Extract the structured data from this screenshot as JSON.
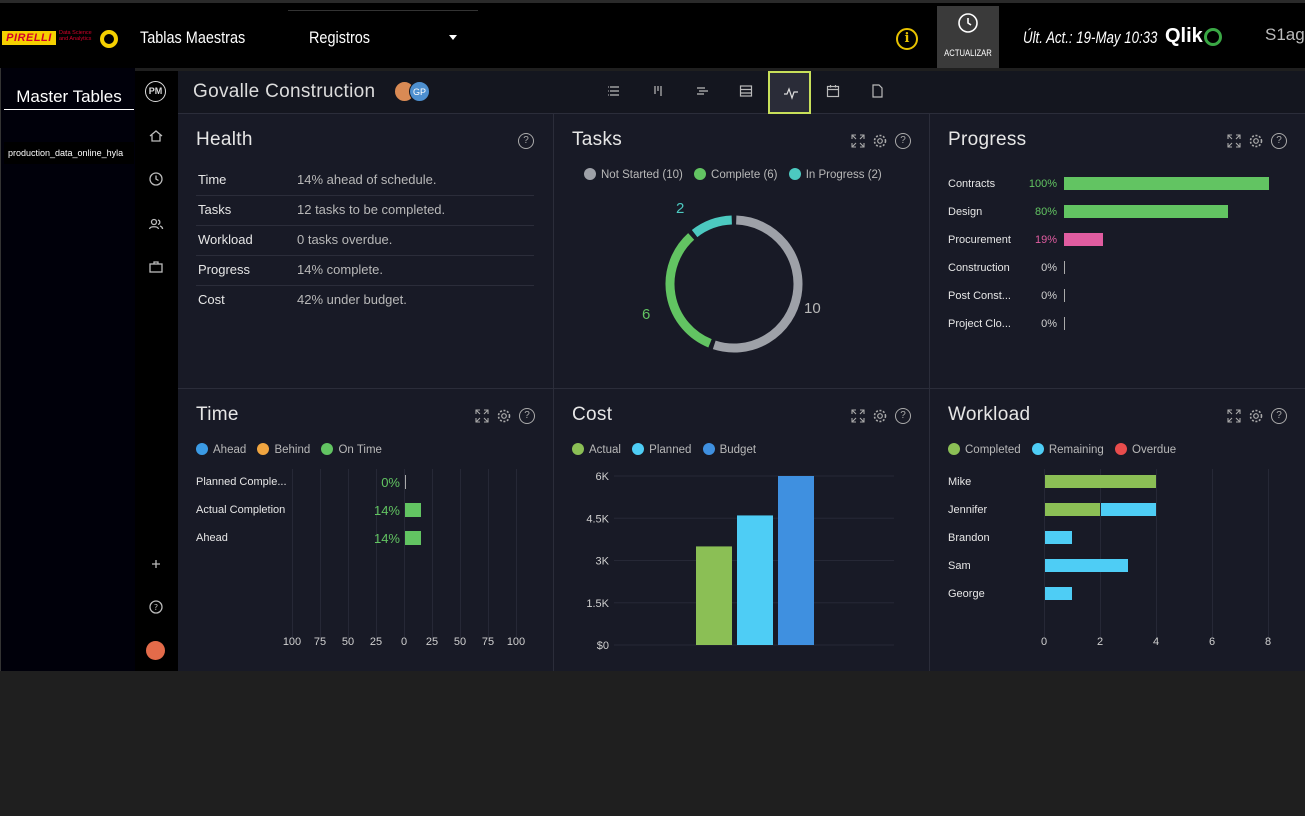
{
  "topbar": {
    "brand": "PIRELLI",
    "brand_sub": "Data Science and Analytics",
    "title": "Tablas Maestras",
    "dropdown": "Registros",
    "info_icon": "info-icon",
    "refresh_label": "ACTUALIZAR",
    "last_update": "Últ. Act.: 19-May 10:33",
    "qlik": "Qlik",
    "partner": "S1ag"
  },
  "qpanel": {
    "title": "Master Tables",
    "items": [
      "production_data_online_hyla"
    ]
  },
  "rail": {
    "logo": "PM",
    "icons": [
      "home-icon",
      "clock-icon",
      "users-icon",
      "briefcase-icon",
      "plus-icon",
      "help-icon"
    ]
  },
  "header": {
    "project": "Govalle Construction",
    "avatar2": "GP",
    "views": [
      "list-view",
      "gantt-view",
      "board-view",
      "sheet-view",
      "dashboard-view",
      "calendar-view",
      "file-view"
    ]
  },
  "health": {
    "title": "Health",
    "rows": [
      {
        "k": "Time",
        "v": "14% ahead of schedule."
      },
      {
        "k": "Tasks",
        "v": "12 tasks to be completed."
      },
      {
        "k": "Workload",
        "v": "0 tasks overdue."
      },
      {
        "k": "Progress",
        "v": "14% complete."
      },
      {
        "k": "Cost",
        "v": "42% under budget."
      }
    ]
  },
  "tasks": {
    "title": "Tasks",
    "legend": [
      "Not Started (10)",
      "Complete (6)",
      "In Progress (2)"
    ],
    "colors": [
      "#9ea1a8",
      "#62c462",
      "#4cc9c0"
    ],
    "chart_data": {
      "type": "pie",
      "categories": [
        "Not Started",
        "Complete",
        "In Progress"
      ],
      "values": [
        10,
        6,
        2
      ]
    },
    "labels": [
      "10",
      "6",
      "2"
    ]
  },
  "progress": {
    "title": "Progress",
    "rows": [
      {
        "k": "Contracts",
        "v": "100%",
        "pct": 100,
        "color": "#62c462"
      },
      {
        "k": "Design",
        "v": "80%",
        "pct": 80,
        "color": "#62c462"
      },
      {
        "k": "Procurement",
        "v": "19%",
        "pct": 19,
        "color": "#e05ca0"
      },
      {
        "k": "Construction",
        "v": "0%",
        "pct": 0,
        "color": "#aaaaaa"
      },
      {
        "k": "Post Const...",
        "v": "0%",
        "pct": 0,
        "color": "#aaaaaa"
      },
      {
        "k": "Project Clo...",
        "v": "0%",
        "pct": 0,
        "color": "#aaaaaa"
      }
    ]
  },
  "time": {
    "title": "Time",
    "legend": [
      "Ahead",
      "Behind",
      "On Time"
    ],
    "colors": [
      "#3b9be5",
      "#f0a540",
      "#62c462"
    ],
    "chart_data": {
      "type": "bar",
      "categories": [
        "Planned Comple...",
        "Actual Completion",
        "Ahead"
      ],
      "values": [
        0,
        14,
        14
      ],
      "value_labels": [
        "0%",
        "14%",
        "14%"
      ],
      "xticks": [
        "100",
        "75",
        "50",
        "25",
        "0",
        "25",
        "50",
        "75",
        "100"
      ]
    }
  },
  "cost": {
    "title": "Cost",
    "legend": [
      "Actual",
      "Planned",
      "Budget"
    ],
    "colors": [
      "#8bbf55",
      "#4ecdf5",
      "#3f90e0"
    ],
    "chart_data": {
      "type": "bar",
      "categories": [
        "Actual",
        "Planned",
        "Budget"
      ],
      "values": [
        3500,
        4600,
        6000
      ],
      "ylim": [
        0,
        6000
      ],
      "yticks": [
        "6K",
        "4.5K",
        "3K",
        "1.5K",
        "$0"
      ]
    }
  },
  "workload": {
    "title": "Workload",
    "legend": [
      "Completed",
      "Remaining",
      "Overdue"
    ],
    "colors": [
      "#8bbf55",
      "#4ecdf5",
      "#e84c4c"
    ],
    "chart_data": {
      "type": "bar",
      "categories": [
        "Mike",
        "Jennifer",
        "Brandon",
        "Sam",
        "George"
      ],
      "series": [
        {
          "name": "Completed",
          "values": [
            4,
            2,
            0,
            0,
            0
          ]
        },
        {
          "name": "Remaining",
          "values": [
            0,
            2,
            1,
            3,
            1
          ]
        }
      ],
      "xlim": [
        0,
        8
      ],
      "xticks": [
        "0",
        "2",
        "4",
        "6",
        "8"
      ]
    }
  }
}
